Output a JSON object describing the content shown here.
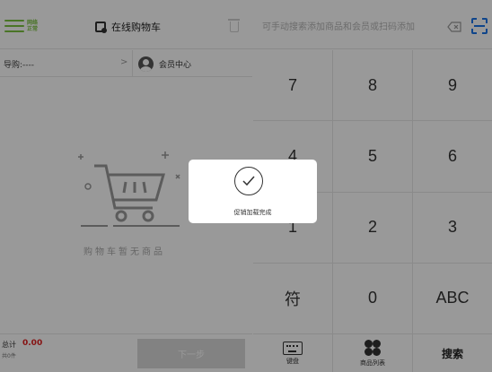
{
  "header": {
    "menu_icon": "menu-icon",
    "net_status": "网络正常",
    "cart_tab_label": "在线购物车",
    "search_placeholder": "可手动搜索添加商品和会员或扫码添加",
    "search_value": ""
  },
  "left": {
    "guide_label": "导购:----",
    "guide_chevron": ">",
    "member_label": "会员中心",
    "empty_cart_text": "购物车暂无商品",
    "total_label": "总计",
    "total_amount": "0.00",
    "item_count": "共0件",
    "next_label": "下一步"
  },
  "keypad": {
    "keys": [
      "7",
      "8",
      "9",
      "4",
      "5",
      "6",
      "1",
      "2",
      "3",
      "符",
      "0",
      "ABC"
    ]
  },
  "bottom_tabs": {
    "keyboard_label": "键盘",
    "product_list_label": "商品列表",
    "search_label": "搜索"
  },
  "toast": {
    "message": "促销加载完成"
  },
  "colors": {
    "accent_green": "#7cc242",
    "amount_red": "#e02020",
    "overlay": "rgba(0,0,0,0.40)"
  }
}
